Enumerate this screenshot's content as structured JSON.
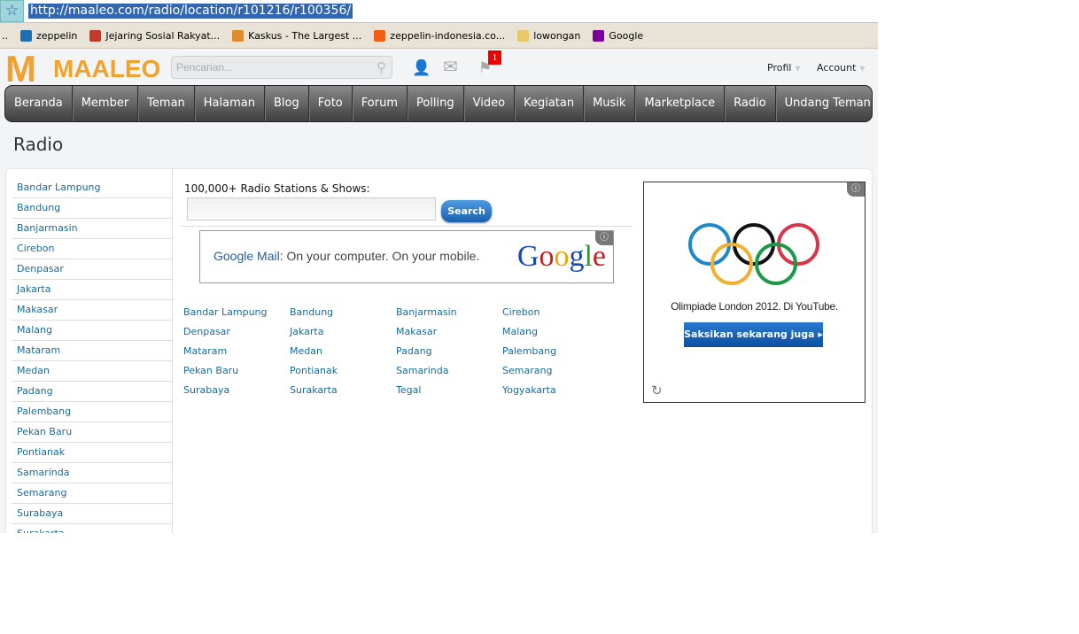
{
  "browser": {
    "url": "http://maaleo.com/radio/location/r101216/r100356/",
    "bookmarks": [
      {
        "label": "zeppelin",
        "icon": "drupal-icon",
        "color": "#1f6fb5"
      },
      {
        "label": "Jejaring Sosial Rakyat...",
        "icon": "flag-icon",
        "color": "#c0392b"
      },
      {
        "label": "Kaskus - The Largest ...",
        "icon": "kaskus-icon",
        "color": "#e08a2b"
      },
      {
        "label": "zeppelin-indonesia.co...",
        "icon": "blogger-icon",
        "color": "#f06010"
      },
      {
        "label": "lowongan",
        "icon": "folder-icon",
        "color": "#e7c96a"
      },
      {
        "label": "Google",
        "icon": "yahoo-icon",
        "color": "#7b0099"
      }
    ]
  },
  "header": {
    "logo": "MAALEO",
    "search_placeholder": "Pencarian...",
    "notification_count": "1",
    "profil": "Profil",
    "account": "Account"
  },
  "nav": [
    "Beranda",
    "Member",
    "Teman",
    "Halaman",
    "Blog",
    "Foto",
    "Forum",
    "Polling",
    "Video",
    "Kegiatan",
    "Musik",
    "Marketplace",
    "Radio",
    "Undang Teman"
  ],
  "page_title": "Radio",
  "sidebar": [
    "Bandar Lampung",
    "Bandung",
    "Banjarmasin",
    "Cirebon",
    "Denpasar",
    "Jakarta",
    "Makasar",
    "Malang",
    "Mataram",
    "Medan",
    "Padang",
    "Palembang",
    "Pekan Baru",
    "Pontianak",
    "Samarinda",
    "Semarang",
    "Surabaya",
    "Surakarta"
  ],
  "radio_search": {
    "label": "100,000+ Radio Stations & Shows:",
    "button": "Search"
  },
  "google_ad": {
    "brand": "Google Mail",
    "text": ": On your computer. On your mobile.",
    "logo": "Google"
  },
  "cities": [
    "Bandar Lampung",
    "Bandung",
    "Banjarmasin",
    "Cirebon",
    "Denpasar",
    "Jakarta",
    "Makasar",
    "Malang",
    "Mataram",
    "Medan",
    "Padang",
    "Palembang",
    "Pekan Baru",
    "Pontianak",
    "Samarinda",
    "Semarang",
    "Surabaya",
    "Surakarta",
    "Tegal",
    "Yogyakarta"
  ],
  "youtube_ad": {
    "caption": "Olimpiade London 2012. Di YouTube.",
    "button": "Saksikan sekarang juga ▸"
  }
}
